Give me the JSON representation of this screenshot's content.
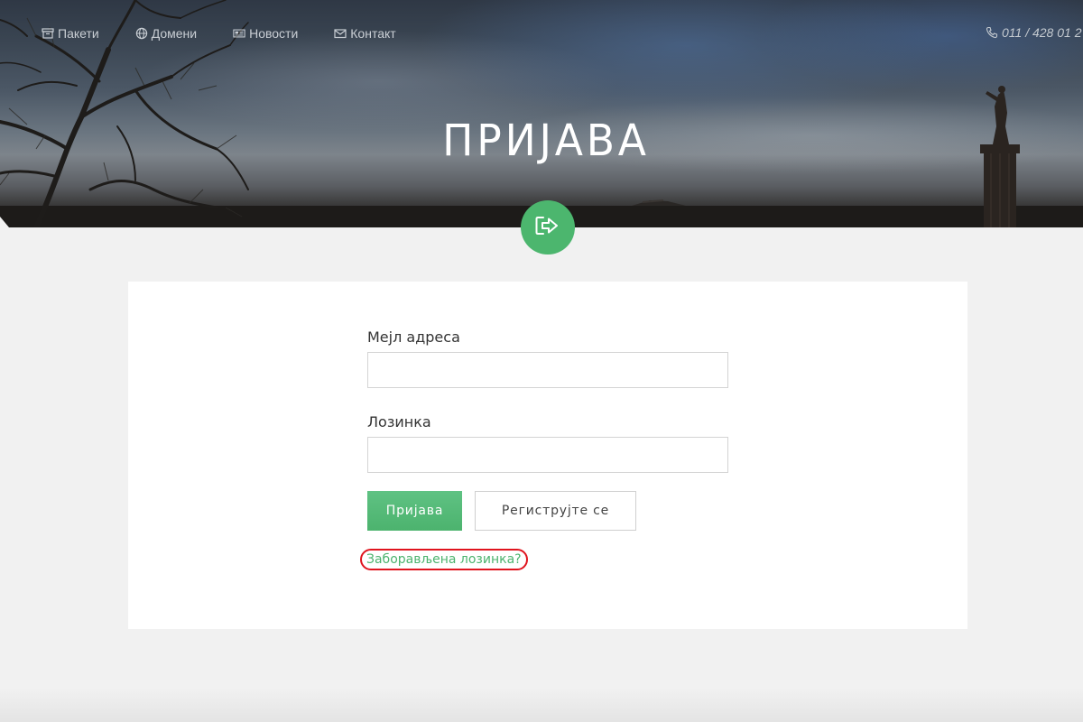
{
  "nav": {
    "items": [
      {
        "label": "Пакети",
        "icon": "archive-box-icon"
      },
      {
        "label": "Домени",
        "icon": "globe-icon"
      },
      {
        "label": "Новости",
        "icon": "newspaper-icon"
      },
      {
        "label": "Контакт",
        "icon": "envelope-icon"
      }
    ],
    "phone": "011 / 428 01 2"
  },
  "hero": {
    "title": "ПРИЈАВА",
    "badge_icon": "sign-in-arrow-icon"
  },
  "form": {
    "email_label": "Мејл адреса",
    "email_value": "",
    "password_label": "Лозинка",
    "password_value": "",
    "login_button": "Пријава",
    "register_button": "Региструјте се",
    "forgot_link": "Заборављена лозинка?"
  },
  "colors": {
    "accent": "#4cb66e",
    "highlight": "#e0141e",
    "background": "#f1f1f1"
  }
}
